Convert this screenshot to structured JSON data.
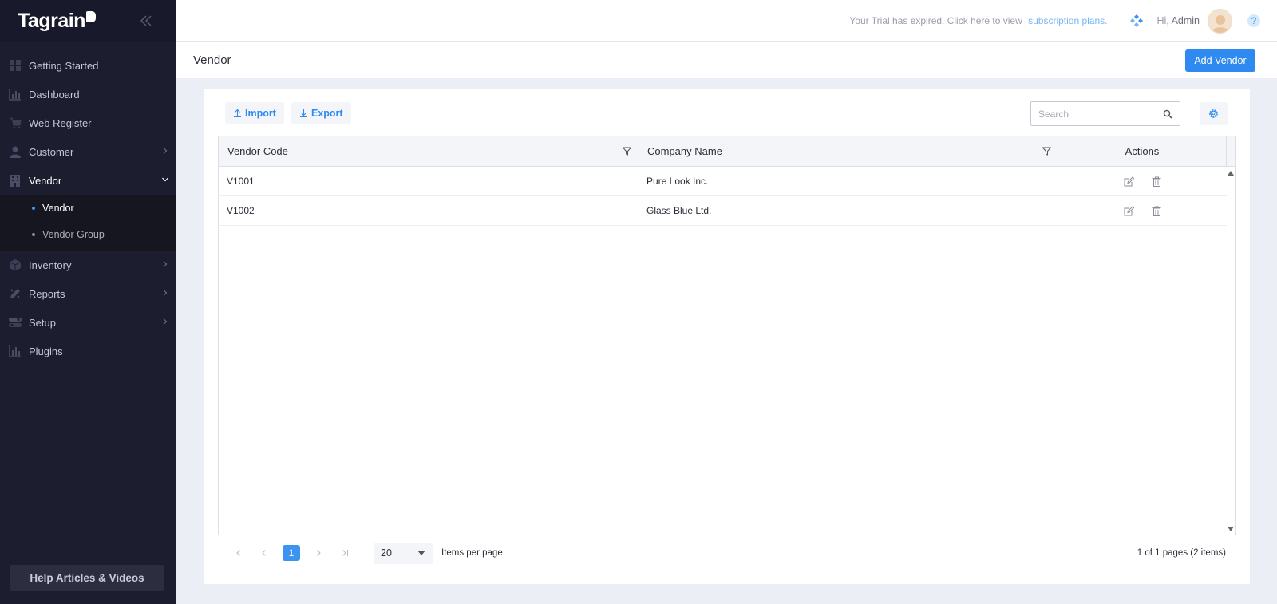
{
  "app": {
    "logo": "Tagrain"
  },
  "sidebar": {
    "items": [
      {
        "label": "Getting Started"
      },
      {
        "label": "Dashboard"
      },
      {
        "label": "Web Register"
      },
      {
        "label": "Customer"
      },
      {
        "label": "Vendor"
      },
      {
        "label": "Inventory"
      },
      {
        "label": "Reports"
      },
      {
        "label": "Setup"
      },
      {
        "label": "Plugins"
      }
    ],
    "vendor_sub": [
      {
        "label": "Vendor"
      },
      {
        "label": "Vendor Group"
      }
    ],
    "help_label": "Help Articles & Videos"
  },
  "topbar": {
    "trial_text": "Your Trial has expired. Click here to view",
    "trial_link": "subscription plans.",
    "greeting": "Hi,",
    "user_name": "Admin"
  },
  "page": {
    "title": "Vendor",
    "add_button": "Add Vendor"
  },
  "toolbar": {
    "import_label": "Import",
    "export_label": "Export",
    "search_placeholder": "Search"
  },
  "grid": {
    "columns": [
      "Vendor Code",
      "Company Name",
      "Actions"
    ],
    "rows": [
      {
        "code": "V1001",
        "company": "Pure Look Inc."
      },
      {
        "code": "V1002",
        "company": "Glass Blue Ltd."
      }
    ]
  },
  "pager": {
    "current_page": "1",
    "page_size": "20",
    "items_per_page_label": "Items per page",
    "info": "1 of 1 pages (2 items)"
  },
  "colors": {
    "sidebar_bg": "#1c1d2e",
    "accent": "#2e8af0",
    "page_bg": "#eceef5"
  }
}
